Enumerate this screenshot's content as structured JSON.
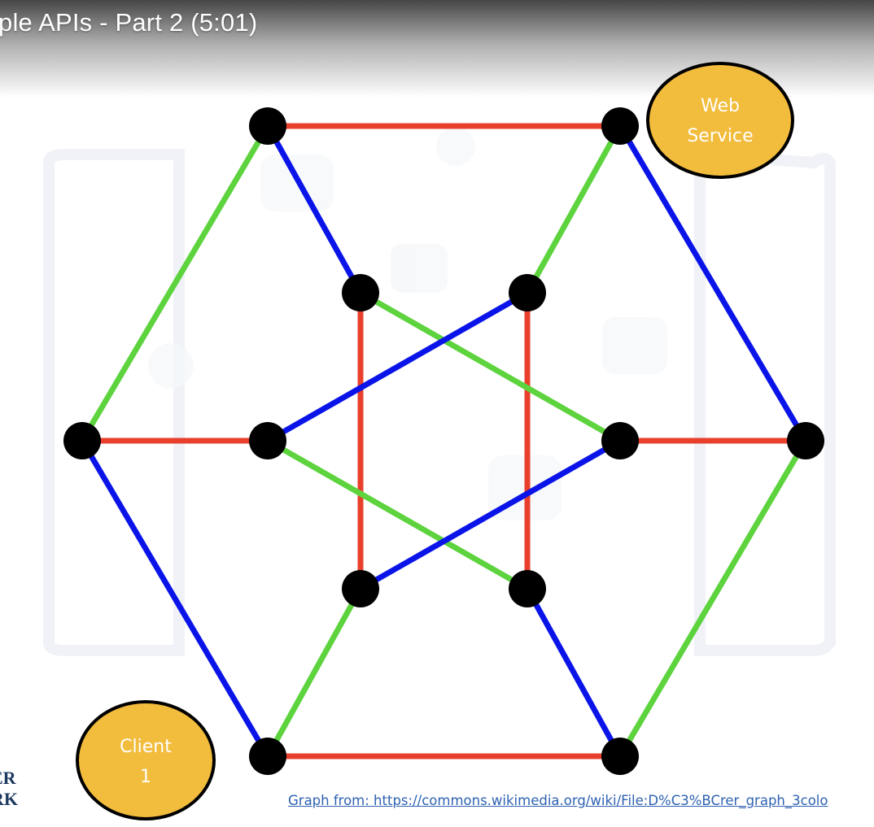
{
  "video": {
    "title": "ple APIs - Part 2 (5:01)"
  },
  "slide": {
    "ellipse_web_service": {
      "line1": "Web",
      "line2": "Service"
    },
    "ellipse_client": {
      "line1": "Client",
      "line2": "1"
    },
    "logo_text": {
      "line1": "ER",
      "line2": "RK"
    },
    "source_link": "Graph from: https://commons.wikimedia.org/wiki/File:D%C3%BCrer_graph_3colo"
  },
  "colors": {
    "red": "#e8402c",
    "green": "#5dd33e",
    "blue": "#0a14e8",
    "node": "#000000",
    "ellipse_fill": "#f2bc3c",
    "link": "#2e62b2"
  }
}
